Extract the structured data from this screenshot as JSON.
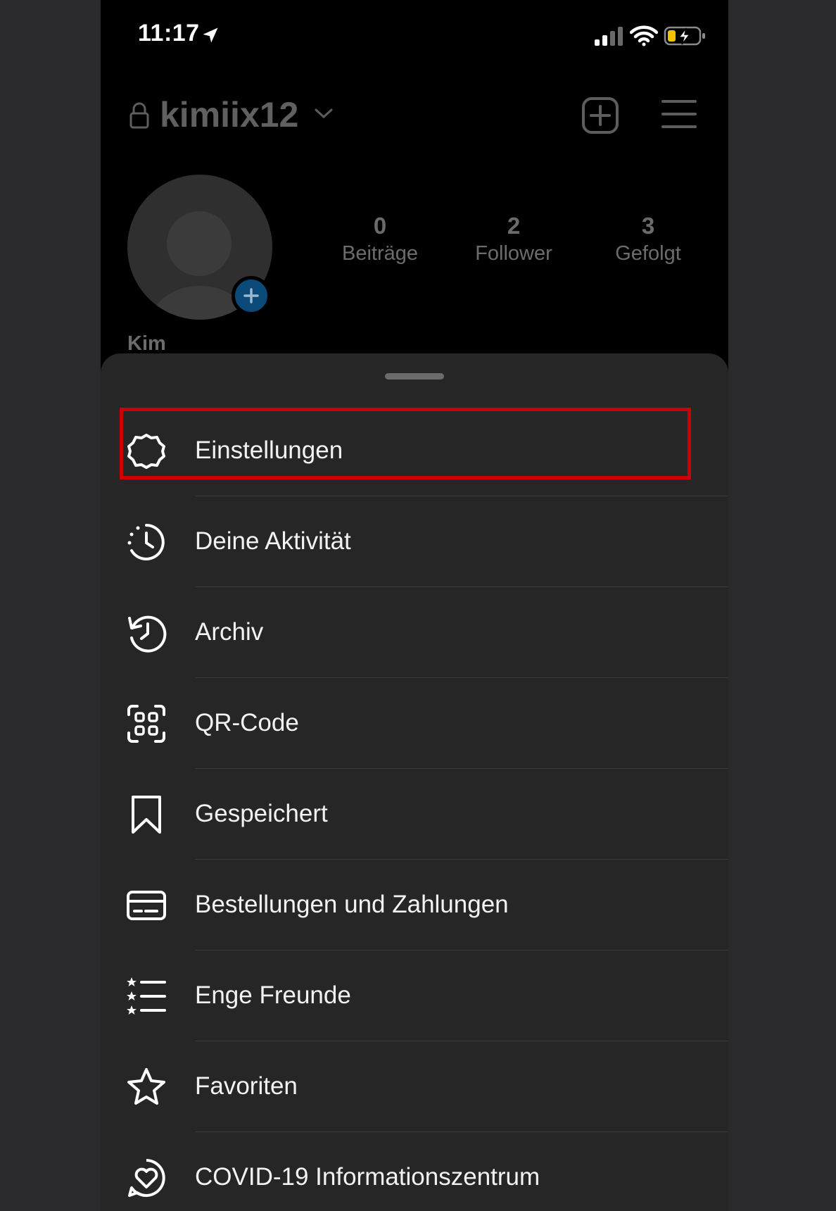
{
  "status_bar": {
    "time": "11:17"
  },
  "header": {
    "username": "kimiix12"
  },
  "profile": {
    "name": "Kim",
    "stats": [
      {
        "value": "0",
        "label": "Beiträge"
      },
      {
        "value": "2",
        "label": "Follower"
      },
      {
        "value": "3",
        "label": "Gefolgt"
      }
    ]
  },
  "menu": {
    "items": [
      {
        "label": "Einstellungen",
        "icon": "settings-gear-icon"
      },
      {
        "label": "Deine Aktivität",
        "icon": "activity-clock-icon"
      },
      {
        "label": "Archiv",
        "icon": "archive-history-icon"
      },
      {
        "label": "QR-Code",
        "icon": "qr-code-icon"
      },
      {
        "label": "Gespeichert",
        "icon": "bookmark-icon"
      },
      {
        "label": "Bestellungen und Zahlungen",
        "icon": "credit-card-icon"
      },
      {
        "label": "Enge Freunde",
        "icon": "star-list-icon"
      },
      {
        "label": "Favoriten",
        "icon": "star-icon"
      },
      {
        "label": "COVID-19 Informationszentrum",
        "icon": "heart-speech-icon"
      }
    ]
  },
  "colors": {
    "highlight": "#cc0000",
    "sheet": "#262626",
    "accent": "#0b4a78"
  }
}
